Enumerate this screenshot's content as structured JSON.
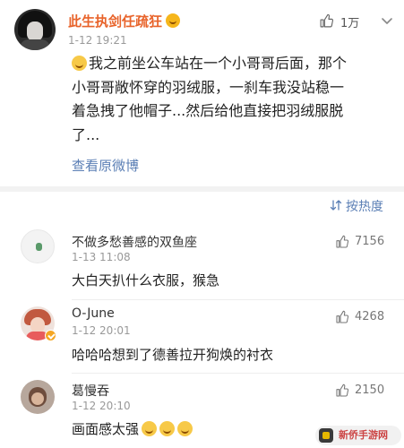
{
  "post": {
    "author": "此生执剑任疏狂",
    "time": "1-12 19:21",
    "likes": "1万",
    "text_lines": [
      "我之前坐公车站在一个小哥哥后面，那个",
      "小哥哥敞怀穿的羽绒服，一刹车我没站稳一",
      "着急拽了他帽子...然后给他直接把羽绒服脱",
      "了..."
    ],
    "view_original": "查看原微博"
  },
  "sort": {
    "label": "按热度"
  },
  "comments": [
    {
      "name": "不做多愁善感的双鱼座",
      "time": "1-13 11:08",
      "likes": "7156",
      "text": "大白天扒什么衣服，猴急"
    },
    {
      "name": "O-June",
      "time": "1-12 20:01",
      "likes": "4268",
      "text": "哈哈哈想到了德善拉开狗焕的衬衣"
    },
    {
      "name": "葛慢吞",
      "time": "1-12 20:10",
      "likes": "2150",
      "text": "画面感太强"
    }
  ],
  "icons": {
    "like": "thumbs-up-icon",
    "more": "chevron-down-icon",
    "sort": "sort-icon"
  },
  "colors": {
    "author": "#e8632a",
    "link": "#5b7fb5",
    "separator": "#f2f2f2"
  },
  "watermark": "新侨手游网"
}
